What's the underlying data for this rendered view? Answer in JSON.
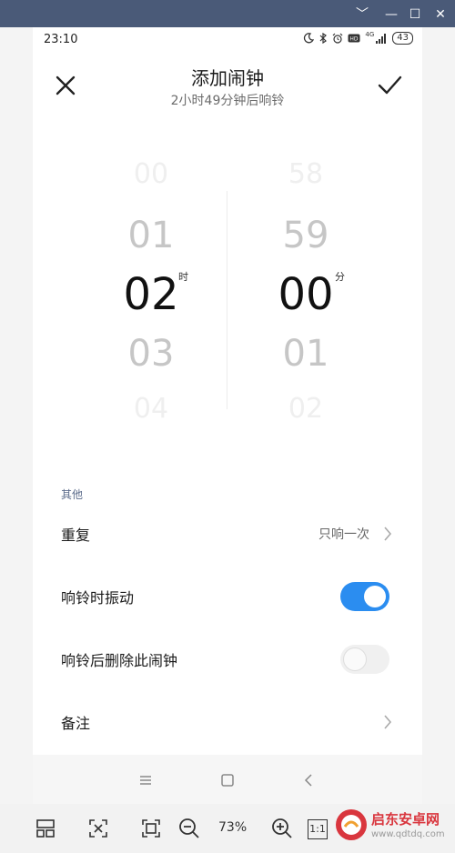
{
  "window": {
    "buttons": {
      "chevron": "﹀",
      "minimize": "—",
      "maximize": "☐",
      "close": "✕"
    }
  },
  "status_bar": {
    "time": "23:10",
    "icons": [
      "moon-icon",
      "bluetooth-icon",
      "alarm-icon",
      "hd-icon",
      "4g-signal-icon"
    ],
    "network": "4G",
    "battery": "43"
  },
  "header": {
    "title": "添加闹钟",
    "subtitle": "2小时49分钟后响铃"
  },
  "picker": {
    "hours": [
      "00",
      "01",
      "02",
      "03",
      "04"
    ],
    "minutes": [
      "58",
      "59",
      "00",
      "01",
      "02"
    ],
    "hour_unit": "时",
    "minute_unit": "分",
    "selected_index": 2
  },
  "settings": {
    "section_title": "其他",
    "repeat_label": "重复",
    "repeat_value": "只响一次",
    "vibrate_label": "响铃时振动",
    "vibrate_on": true,
    "delete_after_label": "响铃后删除此闹钟",
    "delete_after_on": false,
    "note_label": "备注"
  },
  "toolbar": {
    "zoom": "73%",
    "actual_size": "1:1"
  },
  "watermark": {
    "title": "启东安卓网",
    "url": "www.qdtdq.com"
  },
  "colors": {
    "accent": "#2b8df0",
    "titlebar": "#4a5a78",
    "watermark_red": "#d9363e"
  }
}
